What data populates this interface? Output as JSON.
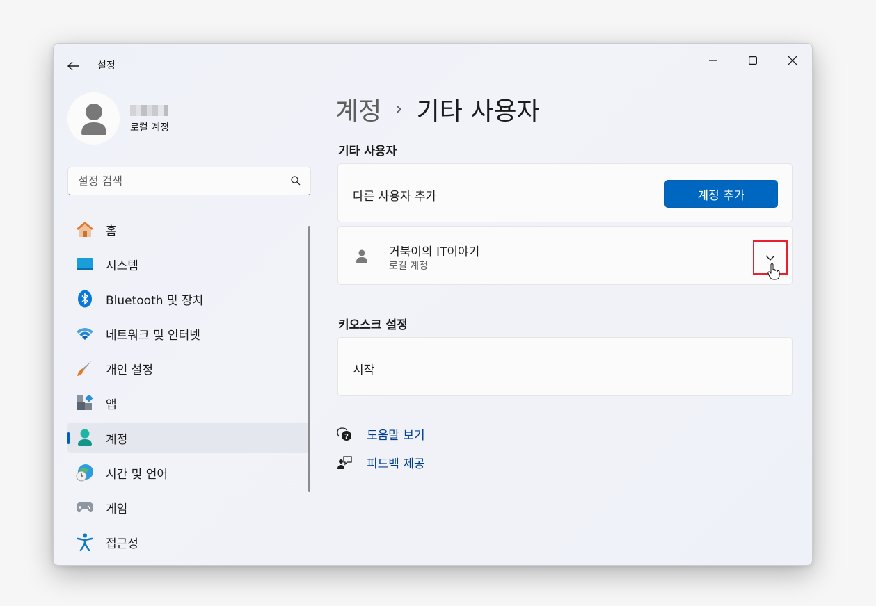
{
  "window": {
    "title": "설정"
  },
  "profile": {
    "account_type": "로컬 계정"
  },
  "search": {
    "placeholder": "설정 검색"
  },
  "nav": {
    "items": [
      {
        "label": "홈",
        "icon": "home-icon"
      },
      {
        "label": "시스템",
        "icon": "system-icon"
      },
      {
        "label": "Bluetooth 및 장치",
        "icon": "bluetooth-icon"
      },
      {
        "label": "네트워크 및 인터넷",
        "icon": "wifi-icon"
      },
      {
        "label": "개인 설정",
        "icon": "paintbrush-icon"
      },
      {
        "label": "앱",
        "icon": "apps-icon"
      },
      {
        "label": "계정",
        "icon": "account-icon",
        "active": true
      },
      {
        "label": "시간 및 언어",
        "icon": "time-language-icon"
      },
      {
        "label": "게임",
        "icon": "gamepad-icon"
      },
      {
        "label": "접근성",
        "icon": "accessibility-icon"
      }
    ]
  },
  "breadcrumb": {
    "parent": "계정",
    "separator": "›",
    "current": "기타 사용자"
  },
  "other_users": {
    "title": "기타 사용자",
    "add_label": "다른 사용자 추가",
    "add_button": "계정 추가",
    "user": {
      "name": "거북이의 IT이야기",
      "type": "로컬 계정"
    }
  },
  "kiosk": {
    "title": "키오스크 설정",
    "start_label": "시작"
  },
  "links": {
    "help": "도움말 보기",
    "feedback": "피드백 제공"
  },
  "colors": {
    "accent": "#0067c0",
    "highlight": "#e8202f",
    "link": "#003e92"
  }
}
